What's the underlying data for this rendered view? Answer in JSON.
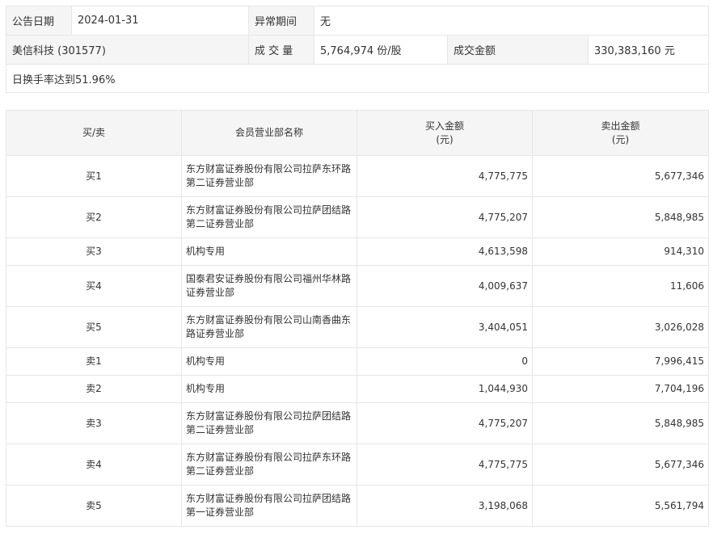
{
  "info": {
    "announce_date_label": "公告日期",
    "announce_date": "2024-01-31",
    "abnormal_period_label": "异常期间",
    "abnormal_period": "无",
    "stock": "美信科技 (301577)",
    "volume_label": "成 交 量",
    "volume": "5,764,974 份/股",
    "amount_label": "成交金额",
    "amount": "330,383,160 元",
    "note": "日换手率达到51.96%"
  },
  "table": {
    "headers": {
      "side": "买/卖",
      "member": "会员营业部名称",
      "buy": "买入金额",
      "buy_unit": "(元)",
      "sell": "卖出金额",
      "sell_unit": "(元)"
    },
    "rows": [
      {
        "side": "买1",
        "name": "东方财富证券股份有限公司拉萨东环路第二证券营业部",
        "buy": "4,775,775",
        "sell": "5,677,346"
      },
      {
        "side": "买2",
        "name": "东方财富证券股份有限公司拉萨团结路第二证券营业部",
        "buy": "4,775,207",
        "sell": "5,848,985"
      },
      {
        "side": "买3",
        "name": "机构专用",
        "buy": "4,613,598",
        "sell": "914,310"
      },
      {
        "side": "买4",
        "name": "国泰君安证券股份有限公司福州华林路证券营业部",
        "buy": "4,009,637",
        "sell": "11,606"
      },
      {
        "side": "买5",
        "name": "东方财富证券股份有限公司山南香曲东路证券营业部",
        "buy": "3,404,051",
        "sell": "3,026,028"
      },
      {
        "side": "卖1",
        "name": "机构专用",
        "buy": "0",
        "sell": "7,996,415"
      },
      {
        "side": "卖2",
        "name": "机构专用",
        "buy": "1,044,930",
        "sell": "7,704,196"
      },
      {
        "side": "卖3",
        "name": "东方财富证券股份有限公司拉萨团结路第二证券营业部",
        "buy": "4,775,207",
        "sell": "5,848,985"
      },
      {
        "side": "卖4",
        "name": "东方财富证券股份有限公司拉萨东环路第二证券营业部",
        "buy": "4,775,775",
        "sell": "5,677,346"
      },
      {
        "side": "卖5",
        "name": "东方财富证券股份有限公司拉萨团结路第一证券营业部",
        "buy": "3,198,068",
        "sell": "5,561,794"
      }
    ]
  }
}
